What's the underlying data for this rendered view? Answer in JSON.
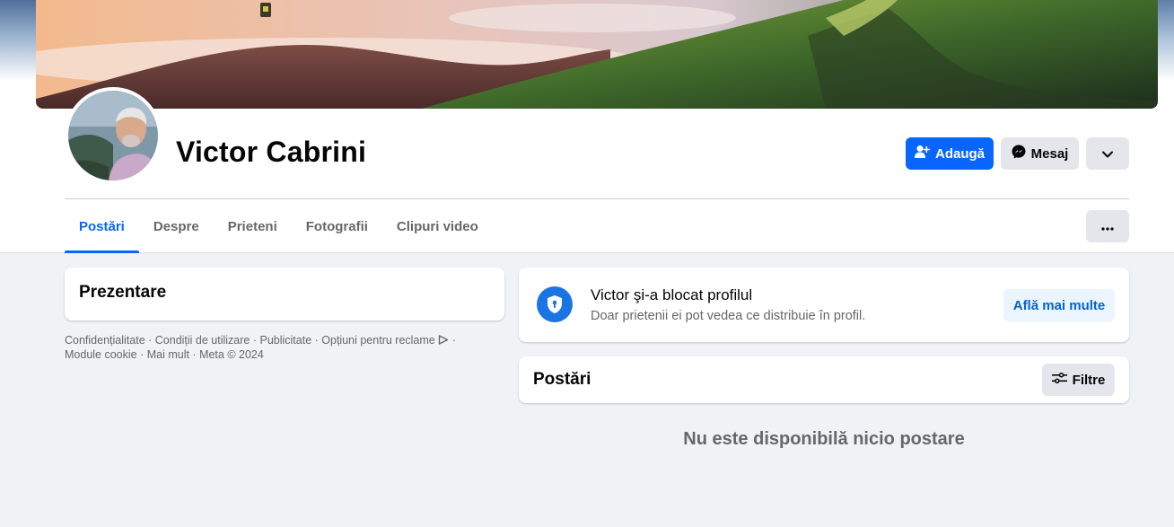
{
  "profile": {
    "name": "Victor Cabrini"
  },
  "actions": {
    "add_label": "Adaugă",
    "message_label": "Mesaj"
  },
  "tabs": [
    {
      "label": "Postări",
      "active": true
    },
    {
      "label": "Despre",
      "active": false
    },
    {
      "label": "Prieteni",
      "active": false
    },
    {
      "label": "Fotografii",
      "active": false
    },
    {
      "label": "Clipuri video",
      "active": false
    }
  ],
  "intro": {
    "title": "Prezentare"
  },
  "footer": {
    "links": [
      "Confidențialitate",
      "Condiții de utilizare",
      "Publicitate",
      "Opțiuni pentru reclame",
      "Module cookie",
      "Mai mult"
    ],
    "copyright": "Meta © 2024"
  },
  "locked": {
    "title": "Victor şi-a blocat profilul",
    "subtitle": "Doar prietenii ei pot vedea ce distribuie în profil.",
    "learn_more": "Află mai multe"
  },
  "posts": {
    "title": "Postări",
    "filters_label": "Filtre",
    "empty_message": "Nu este disponibilă nicio postare"
  },
  "icons": {
    "add_friend": "add-friend-icon",
    "messenger": "messenger-icon",
    "chevron": "chevron-down-icon",
    "more": "more-dots-icon",
    "shield": "shield-lock-icon",
    "filters": "filters-icon",
    "ad_choices": "ad-choices-icon"
  },
  "colors": {
    "primary": "#0866ff",
    "secondary_button": "#e4e6eb",
    "page_background": "#f0f2f5",
    "shield": "#1b74e4"
  }
}
